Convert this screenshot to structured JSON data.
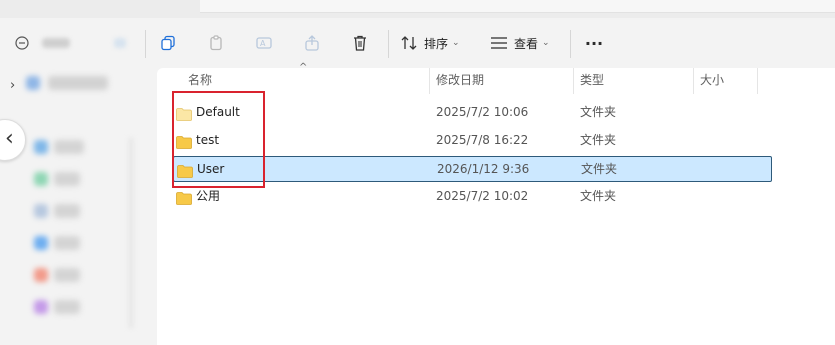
{
  "toolbar": {
    "sort_label": "排序",
    "view_label": "查看",
    "more_label": "···"
  },
  "columns": {
    "name": "名称",
    "modified": "修改日期",
    "type": "类型",
    "size": "大小"
  },
  "files": [
    {
      "name": "Default",
      "modified": "2025/7/2 10:06",
      "type": "文件夹",
      "selected": false
    },
    {
      "name": "test",
      "modified": "2025/7/8 16:22",
      "type": "文件夹",
      "selected": false
    },
    {
      "name": "User",
      "modified": "2026/1/12 9:36",
      "type": "文件夹",
      "selected": true
    },
    {
      "name": "公用",
      "modified": "2025/7/2 10:02",
      "type": "文件夹",
      "selected": false
    }
  ],
  "colors": {
    "selection_bg": "#cce8ff",
    "selection_border": "#2e5a7a",
    "highlight_box": "#d9232e",
    "folder": "#f5c542"
  }
}
